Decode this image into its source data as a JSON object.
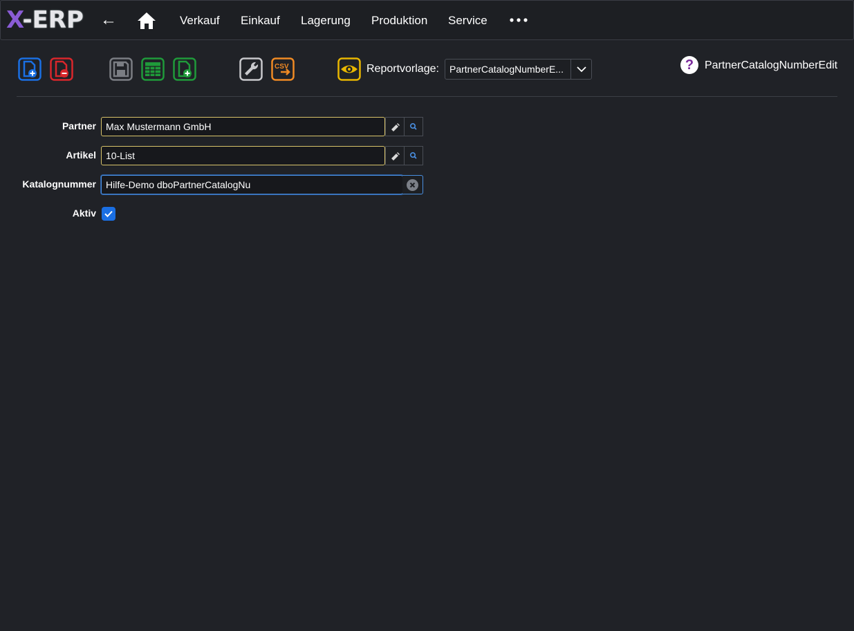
{
  "app": {
    "logo_x": "X",
    "logo_rest": "-ERP"
  },
  "nav": {
    "back_glyph": "←",
    "items": [
      "Verkauf",
      "Einkauf",
      "Lagerung",
      "Produktion",
      "Service"
    ]
  },
  "toolbar": {
    "buttons": [
      {
        "icon": "new-document-icon",
        "color": "#1a6fe3"
      },
      {
        "icon": "delete-document-icon",
        "color": "#d9262b"
      },
      {
        "icon": "save-icon",
        "color": "#7a7d83"
      },
      {
        "icon": "table-icon",
        "color": "#1f9a3a"
      },
      {
        "icon": "add-document-icon",
        "color": "#1f9a3a"
      },
      {
        "icon": "wrench-icon",
        "color": "#c8c8cc"
      },
      {
        "icon": "csv-export-icon",
        "color": "#f08a24"
      },
      {
        "icon": "eye-preview-icon",
        "color": "#e8b600"
      }
    ],
    "report_label": "Reportvorlage:",
    "report_value": "PartnerCatalogNumberE...",
    "help_glyph": "?",
    "page_name": "PartnerCatalogNumberEdit"
  },
  "form": {
    "partner": {
      "label": "Partner",
      "value": "Max Mustermann GmbH"
    },
    "artikel": {
      "label": "Artikel",
      "value": "10-List"
    },
    "katalognummer": {
      "label": "Katalognummer",
      "value": "Hilfe-Demo dboPartnerCatalogNu"
    },
    "aktiv": {
      "label": "Aktiv",
      "checked": true
    }
  },
  "colors": {
    "background": "#202227",
    "field_border": "#d9c46a",
    "focus_border": "#4a90e2",
    "checkbox": "#1a6fe3"
  }
}
